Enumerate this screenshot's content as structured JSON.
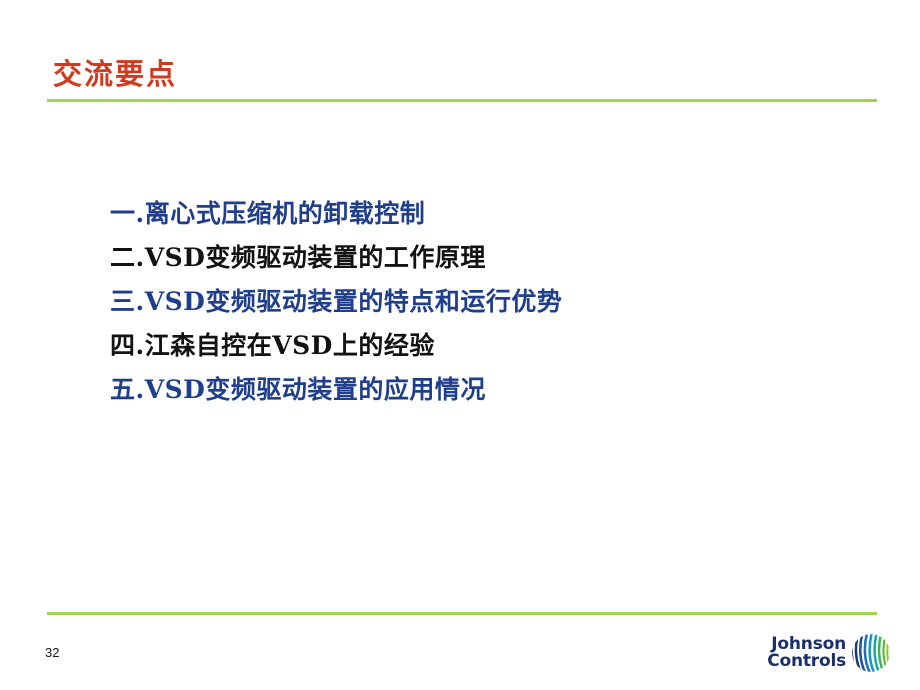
{
  "slide": {
    "title": "交流要点",
    "title_color": "#CF3B1E",
    "rule_color": "#9ED54C",
    "background_color": "#FFFFFF",
    "page_number": "32"
  },
  "agenda": {
    "items": [
      {
        "text": "一.离心式压缩机的卸载控制",
        "color": "#1F3E8C",
        "tone": "blue"
      },
      {
        "text": "二.VSD变频驱动装置的工作原理",
        "color": "#121212",
        "tone": "black"
      },
      {
        "text": "三.VSD变频驱动装置的特点和运行优势",
        "color": "#1F3E8C",
        "tone": "blue"
      },
      {
        "text": "四.江森自控在VSD上的经验",
        "color": "#121212",
        "tone": "black"
      },
      {
        "text": "五.VSD变频驱动装置的应用情况",
        "color": "#1F3E8C",
        "tone": "blue"
      }
    ]
  },
  "logo": {
    "line1": "Johnson",
    "line2": "Controls",
    "wordmark_color": "#1B2F6B",
    "mark_colors": {
      "navy": "#1B3A7A",
      "blue": "#1E6FB8",
      "teal": "#1BA3A8",
      "green": "#5CB531",
      "light_green": "#8DC63F"
    }
  }
}
